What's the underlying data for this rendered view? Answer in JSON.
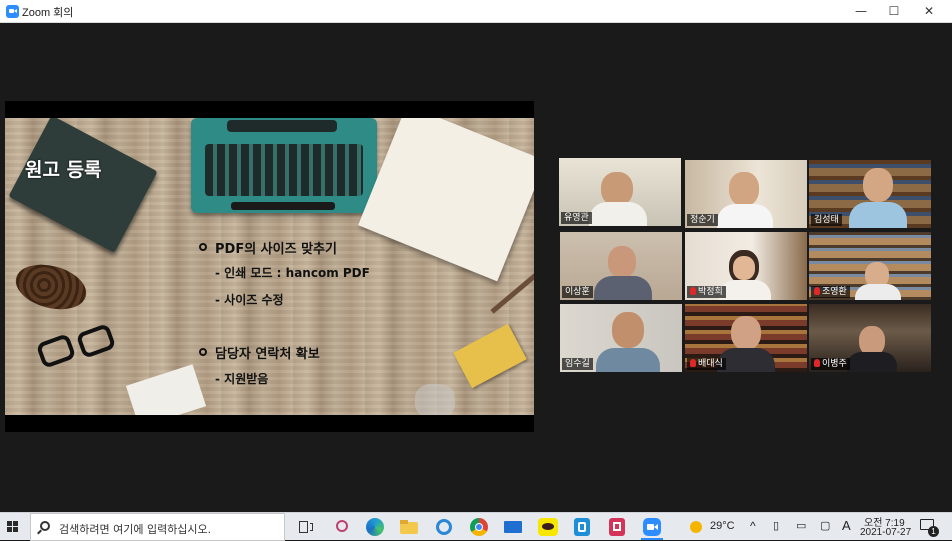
{
  "window": {
    "title": "Zoom 회의",
    "controls": [
      "minimize",
      "maximize",
      "close"
    ]
  },
  "slide": {
    "title": "원고 등록",
    "bullets": [
      {
        "text": "PDF의 사이즈 맞추기",
        "subs": [
          "- 인쇄 모드 : hancom PDF",
          "- 사이즈 수정"
        ]
      },
      {
        "text": "담당자 연락처 확보",
        "subs": [
          "- 지원받음"
        ]
      }
    ]
  },
  "participants": [
    {
      "name": "유영관",
      "muted": false,
      "active": true
    },
    {
      "name": "정순기",
      "muted": false,
      "active": false
    },
    {
      "name": "김성태",
      "muted": false,
      "active": false
    },
    {
      "name": "이상훈",
      "muted": false,
      "active": false
    },
    {
      "name": "박정희",
      "muted": true,
      "active": false
    },
    {
      "name": "조영환",
      "muted": true,
      "active": false
    },
    {
      "name": "임수길",
      "muted": false,
      "active": false
    },
    {
      "name": "배대식",
      "muted": true,
      "active": false
    },
    {
      "name": "이병주",
      "muted": true,
      "active": false
    }
  ],
  "taskbar": {
    "search_placeholder": "검색하려면 여기에 입력하십시오.",
    "apps": [
      "task-view",
      "snipping",
      "edge",
      "file-explorer",
      "internet-explorer",
      "chrome",
      "mail",
      "kakaotalk",
      "store-app",
      "crop-app",
      "zoom"
    ],
    "weather": "29°C",
    "ime": "A",
    "time": "오전 7:19",
    "date": "2021-07-27",
    "notifications": "1"
  },
  "colors": {
    "zoom_blue": "#2d8cff",
    "active_speaker": "#e6e23c",
    "muted": "#e02828"
  }
}
